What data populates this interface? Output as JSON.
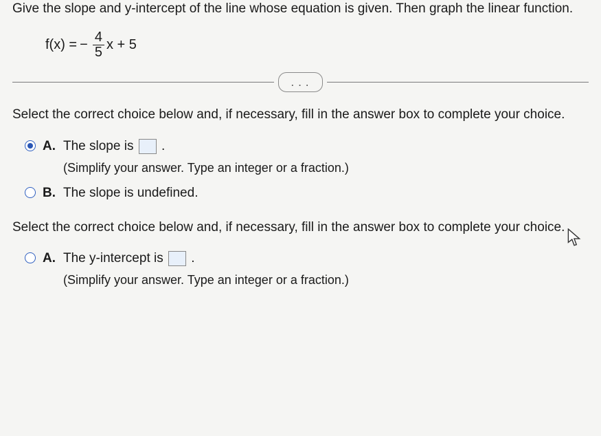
{
  "header": "Give the slope and y-intercept of the line whose equation is given. Then graph the linear function.",
  "equation": {
    "lhs": "f(x) = ",
    "neg": "−",
    "num": "4",
    "den": "5",
    "suffix": "x + 5"
  },
  "more_dots": ". . .",
  "instruction1": "Select the correct choice below and, if necessary, fill in the answer box to complete your choice.",
  "choices1": {
    "a_letter": "A.",
    "a_text_before": "The slope is ",
    "a_text_after": ".",
    "a_hint": "(Simplify your answer. Type an integer or a fraction.)",
    "b_letter": "B.",
    "b_text": "The slope is undefined."
  },
  "instruction2": "Select the correct choice below and, if necessary, fill in the answer box to complete your choice.",
  "choices2": {
    "a_letter": "A.",
    "a_text_before": "The y-intercept is ",
    "a_text_after": ".",
    "a_hint": "(Simplify your answer. Type an integer or a fraction.)"
  }
}
